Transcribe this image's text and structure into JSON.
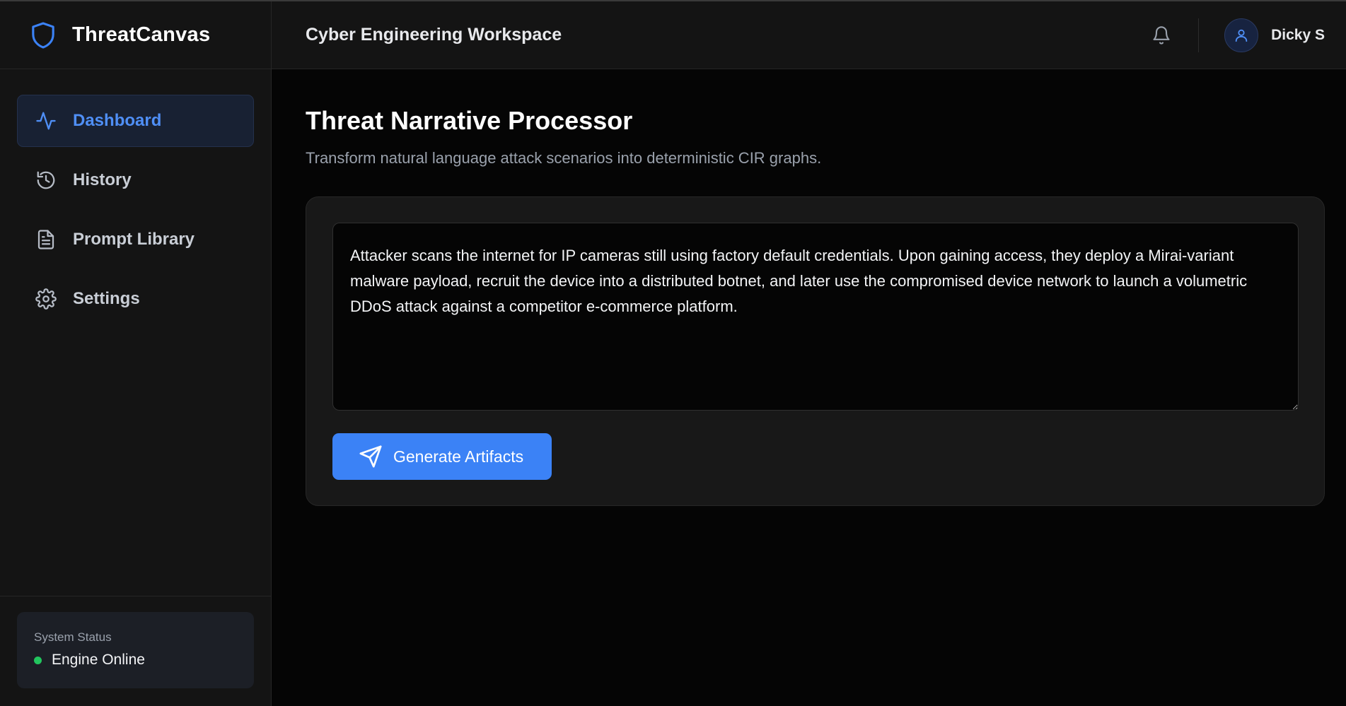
{
  "app": {
    "name": "ThreatCanvas"
  },
  "header": {
    "workspace_title": "Cyber Engineering Workspace",
    "user_name": "Dicky S"
  },
  "sidebar": {
    "items": [
      {
        "label": "Dashboard",
        "icon": "activity-icon",
        "active": true
      },
      {
        "label": "History",
        "icon": "history-icon",
        "active": false
      },
      {
        "label": "Prompt Library",
        "icon": "document-icon",
        "active": false
      },
      {
        "label": "Settings",
        "icon": "gear-icon",
        "active": false
      }
    ],
    "status": {
      "title": "System Status",
      "text": "Engine Online",
      "color": "#22c55e"
    }
  },
  "main": {
    "title": "Threat Narrative Processor",
    "subtitle": "Transform natural language attack scenarios into deterministic CIR graphs.",
    "narrative": "Attacker scans the internet for IP cameras still using factory default credentials. Upon gaining access, they deploy a Mirai-variant malware payload, recruit the device into a distributed botnet, and later use the compromised device network to launch a volumetric DDoS attack against a competitor e-commerce platform.",
    "generate_label": "Generate Artifacts"
  },
  "colors": {
    "accent": "#3b82f6",
    "active_text": "#4f8ff6",
    "background": "#050505",
    "panel": "#181818"
  }
}
